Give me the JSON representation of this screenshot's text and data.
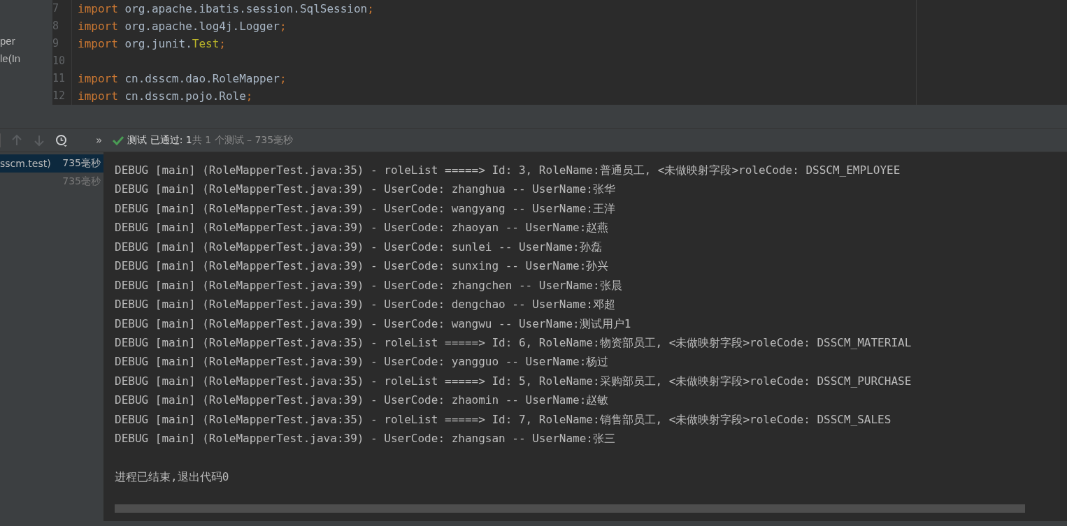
{
  "project_tree": {
    "items": [
      {
        "label": "per"
      },
      {
        "label": "le(In"
      }
    ]
  },
  "editor": {
    "lines": [
      {
        "number": "7",
        "tokens": [
          {
            "kind": "keyword",
            "text": "import"
          },
          {
            "kind": "plain",
            "text": " org.apache.ibatis.session.SqlSession"
          },
          {
            "kind": "punct",
            "text": ";"
          }
        ]
      },
      {
        "number": "8",
        "tokens": [
          {
            "kind": "keyword",
            "text": "import"
          },
          {
            "kind": "plain",
            "text": " org.apache.log4j.Logger"
          },
          {
            "kind": "punct",
            "text": ";"
          }
        ]
      },
      {
        "number": "9",
        "tokens": [
          {
            "kind": "keyword",
            "text": "import"
          },
          {
            "kind": "plain",
            "text": " org.junit."
          },
          {
            "kind": "annotation",
            "text": "Test"
          },
          {
            "kind": "punct",
            "text": ";"
          }
        ]
      },
      {
        "number": "10"
      },
      {
        "number": "11",
        "tokens": [
          {
            "kind": "keyword",
            "text": "import"
          },
          {
            "kind": "plain",
            "text": " cn.dsscm.dao.RoleMapper"
          },
          {
            "kind": "punct",
            "text": ";"
          }
        ]
      },
      {
        "number": "12",
        "tokens": [
          {
            "kind": "keyword",
            "text": "import"
          },
          {
            "kind": "plain",
            "text": " cn.dsscm.pojo.Role"
          },
          {
            "kind": "punct",
            "text": ";"
          }
        ]
      }
    ]
  },
  "test_toolbar": {
    "more": "»",
    "status_passed": "测试 已通过: 1",
    "status_summary": "共 1 个测试 – 735毫秒"
  },
  "test_tree": {
    "items": [
      {
        "label": "sscm.test)",
        "duration": "735毫秒",
        "selected": true
      },
      {
        "duration": "735毫秒",
        "selected": false
      }
    ]
  },
  "console": {
    "lines": [
      {
        "kind": "log",
        "text": "DEBUG [main] (RoleMapperTest.java:35) - roleList =====> Id: 3, RoleName:普通员工, <未做映射字段>roleCode: DSSCM_EMPLOYEE"
      },
      {
        "kind": "log",
        "text": "DEBUG [main] (RoleMapperTest.java:39) - UserCode: zhanghua -- UserName:张华"
      },
      {
        "kind": "log",
        "text": "DEBUG [main] (RoleMapperTest.java:39) - UserCode: wangyang -- UserName:王洋"
      },
      {
        "kind": "log",
        "text": "DEBUG [main] (RoleMapperTest.java:39) - UserCode: zhaoyan -- UserName:赵燕"
      },
      {
        "kind": "log",
        "text": "DEBUG [main] (RoleMapperTest.java:39) - UserCode: sunlei -- UserName:孙磊"
      },
      {
        "kind": "log",
        "text": "DEBUG [main] (RoleMapperTest.java:39) - UserCode: sunxing -- UserName:孙兴"
      },
      {
        "kind": "log",
        "text": "DEBUG [main] (RoleMapperTest.java:39) - UserCode: zhangchen -- UserName:张晨"
      },
      {
        "kind": "log",
        "text": "DEBUG [main] (RoleMapperTest.java:39) - UserCode: dengchao -- UserName:邓超"
      },
      {
        "kind": "log",
        "text": "DEBUG [main] (RoleMapperTest.java:39) - UserCode: wangwu -- UserName:测试用户1"
      },
      {
        "kind": "log",
        "text": "DEBUG [main] (RoleMapperTest.java:35) - roleList =====> Id: 6, RoleName:物资部员工, <未做映射字段>roleCode: DSSCM_MATERIAL"
      },
      {
        "kind": "log",
        "text": "DEBUG [main] (RoleMapperTest.java:39) - UserCode: yangguo -- UserName:杨过"
      },
      {
        "kind": "log",
        "text": "DEBUG [main] (RoleMapperTest.java:35) - roleList =====> Id: 5, RoleName:采购部员工, <未做映射字段>roleCode: DSSCM_PURCHASE"
      },
      {
        "kind": "log",
        "text": "DEBUG [main] (RoleMapperTest.java:39) - UserCode: zhaomin -- UserName:赵敏"
      },
      {
        "kind": "log",
        "text": "DEBUG [main] (RoleMapperTest.java:35) - roleList =====> Id: 7, RoleName:销售部员工, <未做映射字段>roleCode: DSSCM_SALES"
      },
      {
        "kind": "log",
        "text": "DEBUG [main] (RoleMapperTest.java:39) - UserCode: zhangsan -- UserName:张三"
      },
      {
        "kind": "blank"
      },
      {
        "kind": "system",
        "text": "进程已结束,退出代码0"
      }
    ]
  }
}
